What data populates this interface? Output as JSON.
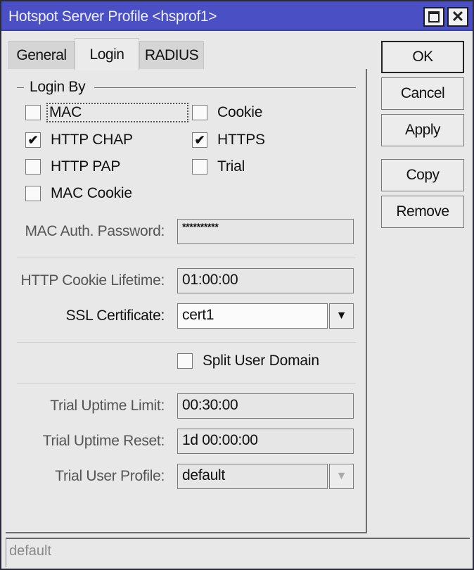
{
  "window": {
    "title": "Hotspot Server Profile <hsprof1>",
    "maximize_icon": "maximize-icon",
    "close_icon": "close-icon"
  },
  "tabs": [
    {
      "label": "General",
      "active": false
    },
    {
      "label": "Login",
      "active": true
    },
    {
      "label": "RADIUS",
      "active": false
    }
  ],
  "login_by": {
    "title": "Login By",
    "options": [
      {
        "label": "MAC",
        "checked": false,
        "focused": true
      },
      {
        "label": "Cookie",
        "checked": false
      },
      {
        "label": "HTTP CHAP",
        "checked": true
      },
      {
        "label": "HTTPS",
        "checked": true
      },
      {
        "label": "HTTP PAP",
        "checked": false
      },
      {
        "label": "Trial",
        "checked": false
      },
      {
        "label": "MAC Cookie",
        "checked": false
      }
    ]
  },
  "fields": {
    "mac_auth_password": {
      "label": "MAC Auth. Password:",
      "value": "**********"
    },
    "http_cookie_lifetime": {
      "label": "HTTP Cookie Lifetime:",
      "value": "01:00:00"
    },
    "ssl_certificate": {
      "label": "SSL Certificate:",
      "value": "cert1"
    },
    "split_user_domain": {
      "label": "Split User Domain",
      "checked": false
    },
    "trial_uptime_limit": {
      "label": "Trial Uptime Limit:",
      "value": "00:30:00"
    },
    "trial_uptime_reset": {
      "label": "Trial Uptime Reset:",
      "value": "1d 00:00:00"
    },
    "trial_user_profile": {
      "label": "Trial User Profile:",
      "value": "default"
    }
  },
  "buttons": {
    "ok": "OK",
    "cancel": "Cancel",
    "apply": "Apply",
    "copy": "Copy",
    "remove": "Remove"
  },
  "status": {
    "text": "default"
  },
  "glyphs": {
    "check": "✔",
    "dropdown": "🠗",
    "close": "✕"
  }
}
